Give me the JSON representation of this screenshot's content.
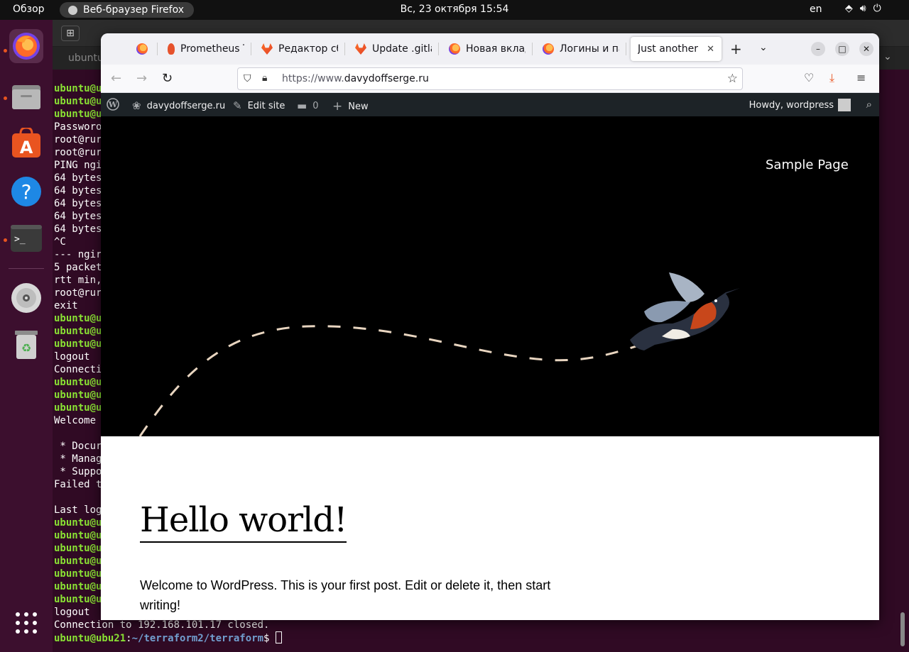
{
  "topbar": {
    "overview": "Обзор",
    "app_name": "Веб-браузер Firefox",
    "clock": "Вс, 23 октября  15:54",
    "lang": "en"
  },
  "dock": {
    "items": [
      "firefox-icon",
      "files-icon",
      "software-icon",
      "help-icon",
      "terminal-icon",
      "disc-icon",
      "trash-icon",
      "apps-grid-icon"
    ]
  },
  "terminal": {
    "tab": "ubuntu",
    "lines": [
      {
        "t": "ubuntu@u",
        "c": "g"
      },
      {
        "t": "ubuntu@u",
        "c": "g"
      },
      {
        "t": "ubuntu@u",
        "c": "g"
      },
      {
        "t": "Passworo",
        "c": ""
      },
      {
        "t": "root@rur",
        "c": ""
      },
      {
        "t": "root@rur",
        "c": ""
      },
      {
        "t": "PING ngi",
        "c": ""
      },
      {
        "t": "64 bytes",
        "c": ""
      },
      {
        "t": "64 bytes",
        "c": ""
      },
      {
        "t": "64 bytes",
        "c": ""
      },
      {
        "t": "64 bytes",
        "c": ""
      },
      {
        "t": "64 bytes",
        "c": ""
      },
      {
        "t": "^C",
        "c": ""
      },
      {
        "t": "--- ngir",
        "c": ""
      },
      {
        "t": "5 packet",
        "c": ""
      },
      {
        "t": "rtt min,",
        "c": ""
      },
      {
        "t": "root@rur",
        "c": ""
      },
      {
        "t": "exit",
        "c": ""
      },
      {
        "t": "ubuntu@u",
        "c": "g"
      },
      {
        "t": "ubuntu@u",
        "c": "g"
      },
      {
        "t": "ubuntu@u",
        "c": "g"
      },
      {
        "t": "logout",
        "c": ""
      },
      {
        "t": "Connecti",
        "c": ""
      },
      {
        "t": "ubuntu@u",
        "c": "g"
      },
      {
        "t": "ubuntu@u",
        "c": "g"
      },
      {
        "t": "ubuntu@u",
        "c": "g"
      },
      {
        "t": "Welcome",
        "c": ""
      },
      {
        "t": "",
        "c": ""
      },
      {
        "t": " * Docur",
        "c": ""
      },
      {
        "t": " * Manag",
        "c": ""
      },
      {
        "t": " * Suppo",
        "c": ""
      },
      {
        "t": "Failed t",
        "c": ""
      },
      {
        "t": "",
        "c": ""
      },
      {
        "t": "Last log",
        "c": ""
      },
      {
        "t": "ubuntu@u",
        "c": "g"
      },
      {
        "t": "ubuntu@u",
        "c": "g"
      },
      {
        "t": "ubuntu@u",
        "c": "g"
      },
      {
        "t": "ubuntu@u",
        "c": "g"
      },
      {
        "t": "ubuntu@u",
        "c": "g"
      },
      {
        "t": "ubuntu@u",
        "c": "g"
      },
      {
        "t": "ubuntu@u",
        "c": "g"
      },
      {
        "t": "logout",
        "c": ""
      },
      {
        "t": "Connection to 192.168.101.17 closed.",
        "c": ""
      }
    ],
    "prompt_user": "ubuntu@ubu21",
    "prompt_path": "~/terraform2/terraform",
    "prompt_sym": "$ "
  },
  "firefox": {
    "tabs": [
      {
        "title": "",
        "favicon": "firefox"
      },
      {
        "title": "Prometheus T",
        "favicon": "prometheus"
      },
      {
        "title": "Редактор сбо",
        "favicon": "gitlab"
      },
      {
        "title": "Update .gitlal",
        "favicon": "gitlab"
      },
      {
        "title": "Новая вклад",
        "favicon": "firefox"
      },
      {
        "title": "Логины и пар",
        "favicon": "firefox"
      },
      {
        "title": "Just another W",
        "favicon": "",
        "active": true
      }
    ],
    "url_prefix": "https://www.",
    "url_domain": "davydoffserge.ru"
  },
  "wpbar": {
    "site": "davydoffserge.ru",
    "edit": "Edit site",
    "comments": "0",
    "new": "New",
    "howdy": "Howdy, wordpress"
  },
  "page": {
    "menu": "Sample Page",
    "title": "Hello world!",
    "body": "Welcome to WordPress. This is your first post. Edit or delete it, then start writing!"
  },
  "colors": {
    "ubuntu_orange": "#e95420",
    "terminal_bg": "#300a24",
    "wp_bar": "#1d2327"
  }
}
